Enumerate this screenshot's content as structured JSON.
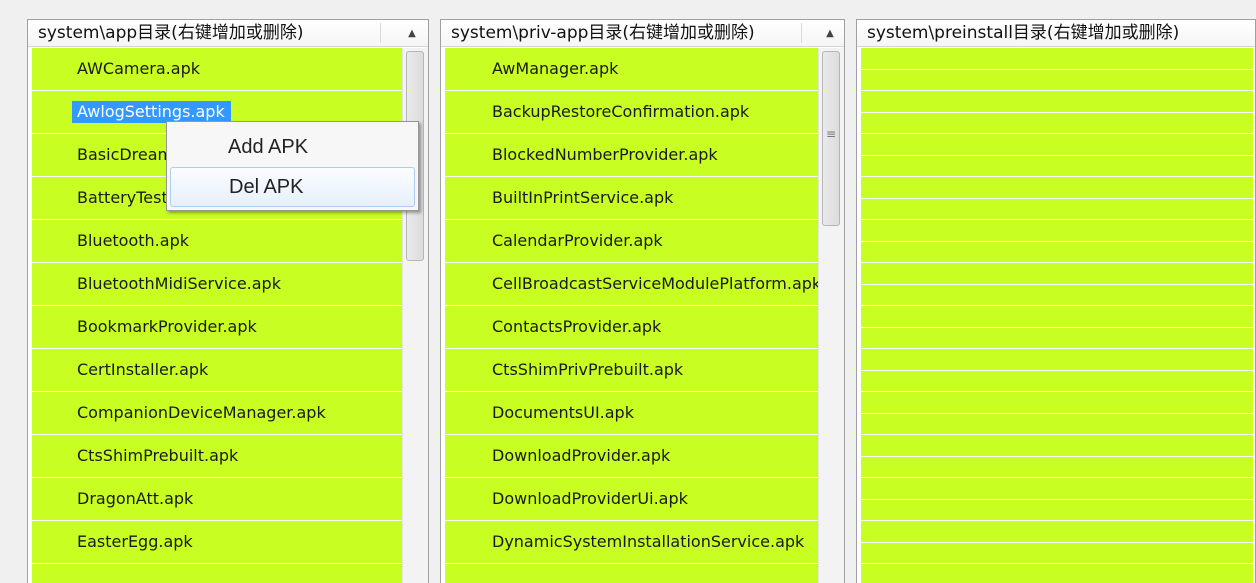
{
  "panels": [
    {
      "header": "system\\app目录(右键增加或删除)",
      "items": [
        "AWCamera.apk",
        "AwlogSettings.apk",
        "BasicDreams.apk",
        "BatteryTest.apk",
        "Bluetooth.apk",
        "BluetoothMidiService.apk",
        "BookmarkProvider.apk",
        "CertInstaller.apk",
        "CompanionDeviceManager.apk",
        "CtsShimPrebuilt.apk",
        "DragonAtt.apk",
        "EasterEgg.apk"
      ],
      "selected_index": 1
    },
    {
      "header": "system\\priv-app目录(右键增加或删除)",
      "items": [
        "AwManager.apk",
        "BackupRestoreConfirmation.apk",
        "BlockedNumberProvider.apk",
        "BuiltInPrintService.apk",
        "CalendarProvider.apk",
        "CellBroadcastServiceModulePlatform.apk",
        "ContactsProvider.apk",
        "CtsShimPrivPrebuilt.apk",
        "DocumentsUI.apk",
        "DownloadProvider.apk",
        "DownloadProviderUi.apk",
        "DynamicSystemInstallationService.apk"
      ]
    },
    {
      "header": "system\\preinstall目录(右键增加或删除)",
      "items": []
    }
  ],
  "context_menu": {
    "add_label": "Add APK",
    "del_label": "Del APK"
  },
  "colors": {
    "row_bg": "#c8fe21",
    "selection": "#3399ff"
  }
}
